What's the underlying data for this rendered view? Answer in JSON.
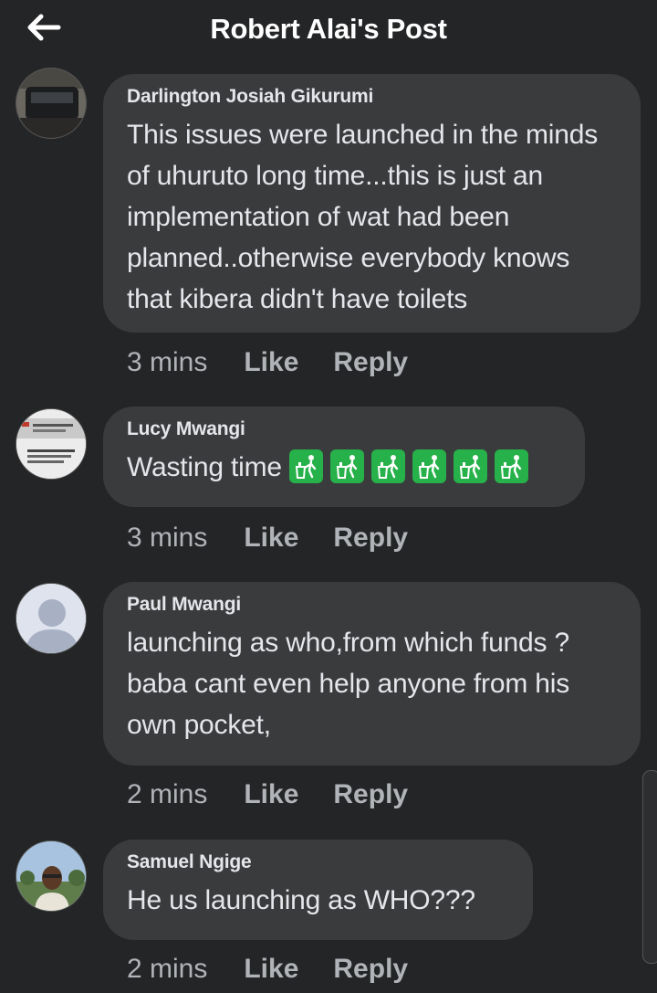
{
  "header": {
    "title": "Robert Alai's Post",
    "back_icon": "arrow-left-icon"
  },
  "comments": [
    {
      "author": "Darlington Josiah Gikurumi",
      "text": "This issues were launched in the minds of uhuruto long time...this is just an implementation of wat had been planned..otherwise everybody knows that kibera didn't have toilets",
      "time": "3 mins",
      "like": "Like",
      "reply": "Reply"
    },
    {
      "author": "Lucy Mwangi",
      "text": "Wasting time",
      "emoji": "litter-in-bin-sign",
      "emoji_count": 6,
      "time": "3 mins",
      "like": "Like",
      "reply": "Reply"
    },
    {
      "author": "Paul Mwangi",
      "text": "launching as who,from which funds ?baba cant even help anyone from his own pocket,",
      "time": "2 mins",
      "like": "Like",
      "reply": "Reply"
    },
    {
      "author": "Samuel Ngige",
      "text": "He us launching as WHO???",
      "time": "2 mins",
      "like": "Like",
      "reply": "Reply"
    }
  ],
  "colors": {
    "background": "#242526",
    "bubble": "#3a3b3c",
    "emoji": "#27b14a"
  }
}
